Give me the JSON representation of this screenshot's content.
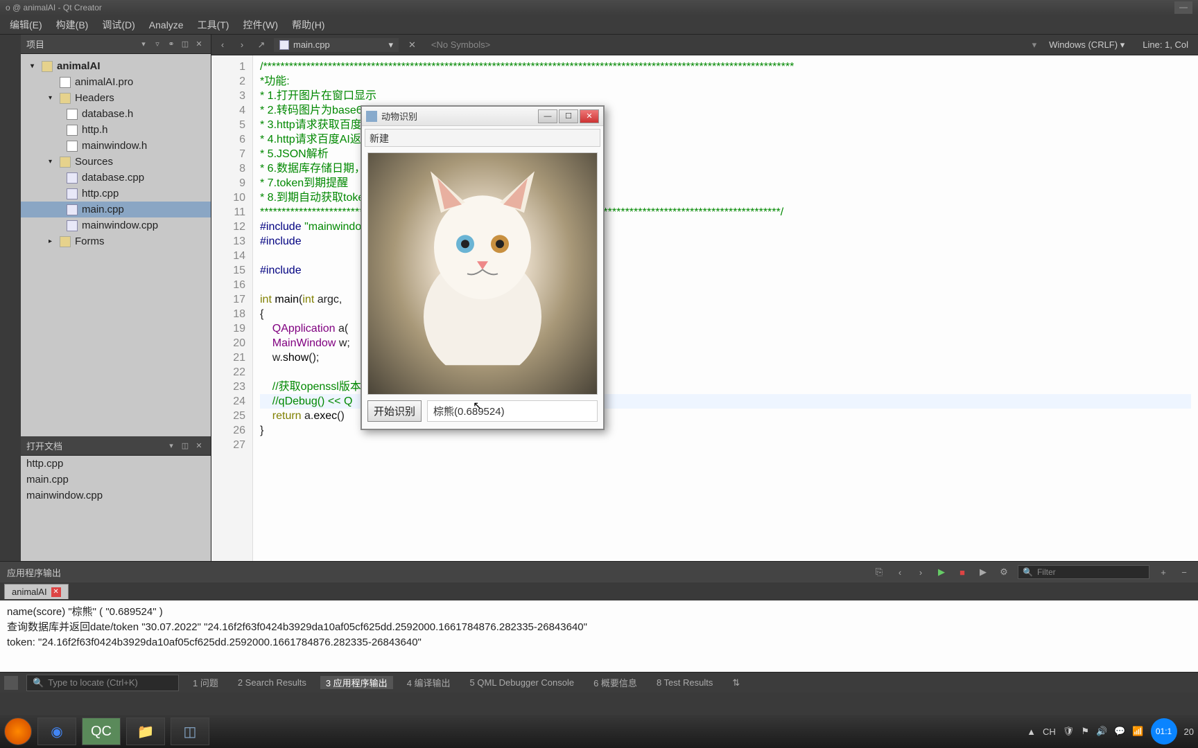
{
  "titlebar": {
    "text": "o @ animalAI - Qt Creator"
  },
  "menu": {
    "edit": "编辑(E)",
    "build": "构建(B)",
    "debug": "调试(D)",
    "analyze": "Analyze",
    "tools": "工具(T)",
    "widgets": "控件(W)",
    "help": "帮助(H)"
  },
  "sidebar": {
    "project_title": "项目",
    "tree": {
      "root": "animalAI",
      "pro": "animalAI.pro",
      "headers": "Headers",
      "h1": "database.h",
      "h2": "http.h",
      "h3": "mainwindow.h",
      "sources": "Sources",
      "s1": "database.cpp",
      "s2": "http.cpp",
      "s3": "main.cpp",
      "s4": "mainwindow.cpp",
      "forms": "Forms"
    },
    "docs_title": "打开文档",
    "docs": [
      "http.cpp",
      "main.cpp",
      "mainwindow.cpp"
    ]
  },
  "editor": {
    "file": "main.cpp",
    "symbols": "<No Symbols>",
    "encoding": "Windows (CRLF)",
    "linecol": "Line: 1, Col",
    "lines": [
      "/***************************************************************************************************************************",
      "*功能:",
      "* 1.打开图片在窗口显示",
      "* 2.转码图片为base64",
      "* 3.http请求获取百度A",
      "* 4.http请求百度AI返回",
      "* 5.JSON解析",
      "* 6.数据库存储日期，to",
      "* 7.token到期提醒",
      "* 8.到期自动获取token",
      "***************************************************************            *************************************************/",
      "#include \"mainwindo",
      "#include <QSslSocket",
      "",
      "#include <QApplicat",
      "",
      "int main(int argc,",
      "{",
      "    QApplication a(",
      "    MainWindow w;",
      "    w.show();",
      "",
      "    //获取openssl版本",
      "    //qDebug() << Q                                           () <<QSslSocket::supportsSsl();",
      "    return a.exec()",
      "}",
      ""
    ]
  },
  "output": {
    "title": "应用程序输出",
    "filter_placeholder": "Filter",
    "tab": "animalAI",
    "lines": [
      "name(score) \"棕熊\" ( \"0.689524\" )",
      "查询数据库并返回date/token \"30.07.2022\" \"24.16f2f63f0424b3929da10af05cf625dd.2592000.1661784876.282335-26843640\"",
      "token: \"24.16f2f63f0424b3929da10af05cf625dd.2592000.1661784876.282335-26843640\""
    ]
  },
  "status": {
    "search_placeholder": "Type to locate (Ctrl+K)",
    "tabs": {
      "t1": "1  问题",
      "t2": "2  Search Results",
      "t3": "3  应用程序输出",
      "t4": "4  编译输出",
      "t5": "5  QML Debugger Console",
      "t6": "6  概要信息",
      "t8": "8  Test Results"
    }
  },
  "appwin": {
    "title": "动物识别",
    "menu": "新建",
    "button": "开始识别",
    "result": "棕熊(0.689524)"
  },
  "taskbar": {
    "clock": "01:1",
    "time_suffix": "20",
    "ime": "CH"
  }
}
